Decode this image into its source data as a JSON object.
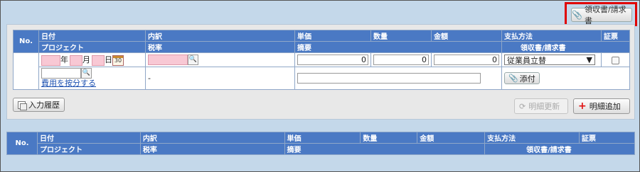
{
  "receipt_button": {
    "label": "領収書/請求書",
    "icon": "paperclip-icon"
  },
  "entry": {
    "headers": {
      "no": "No.",
      "date": "日付",
      "breakdown": "内訳",
      "unit_price": "単価",
      "quantity": "数量",
      "amount": "金額",
      "payment_method": "支払方法",
      "voucher": "証票",
      "project": "プロジェクト",
      "tax_rate": "税率",
      "summary": "摘要",
      "receipt_invoice": "領収書/請求書"
    },
    "date": {
      "year": "",
      "year_label": "年",
      "month": "",
      "month_label": "月",
      "day": "",
      "day_label": "日",
      "calendar_text": "30"
    },
    "breakdown_value": "",
    "unit_price_value": "0",
    "quantity_value": "0",
    "amount_value": "0",
    "payment_method_value": "従業員立替",
    "voucher_checked": false,
    "project_value": "",
    "allocate_link": "費用を按分する",
    "tax_rate_value": "-",
    "summary_value": "",
    "attach_label": "添付"
  },
  "buttons": {
    "input_history": "入力履歴",
    "update_detail": "明細更新",
    "add_detail": "明細追加"
  },
  "list": {
    "headers": {
      "no": "No.",
      "date": "日付",
      "breakdown": "内訳",
      "unit_price": "単価",
      "quantity": "数量",
      "amount": "金額",
      "payment_method": "支払方法",
      "voucher": "証票",
      "project": "プロジェクト",
      "tax_rate": "税率",
      "summary": "摘要",
      "receipt_invoice": "領収書/請求書"
    }
  }
}
